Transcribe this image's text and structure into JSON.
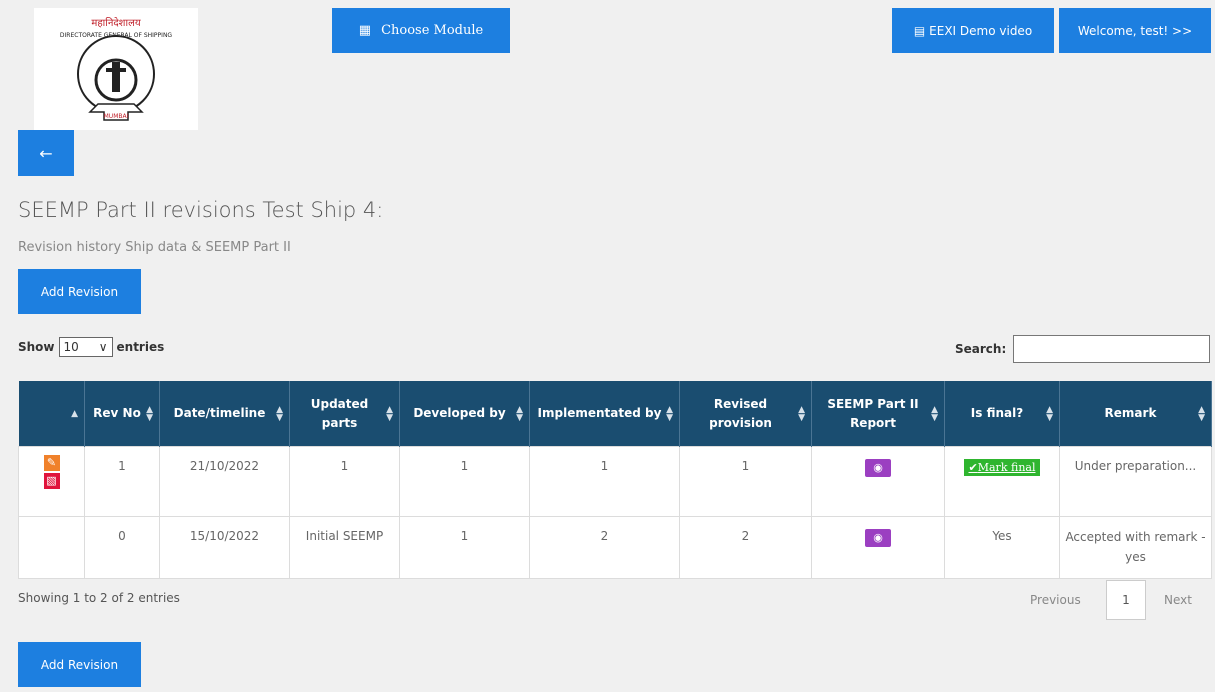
{
  "header": {
    "logo_text": "DIRECTORATE GENERAL OF SHIPPING",
    "logo_sub": "MUMBAI",
    "choose_module": "Choose Module",
    "demo_video": "EEXI Demo video",
    "welcome": "Welcome, test! >>"
  },
  "page": {
    "title": "SEEMP Part II revisions Test Ship 4:",
    "subtitle": "Revision history Ship data & SEEMP Part II",
    "add_revision": "Add Revision"
  },
  "controls": {
    "show_label": "Show",
    "entries_value": "10",
    "entries_label": "entries",
    "search_label": "Search:"
  },
  "table": {
    "headers": [
      "",
      "Rev No",
      "Date/timeline",
      "Updated parts",
      "Developed by",
      "Implementated by",
      "Revised provision",
      "SEEMP Part II Report",
      "Is final?",
      "Remark"
    ],
    "rows": [
      {
        "rev_no": "1",
        "date": "21/10/2022",
        "updated": "1",
        "developed": "1",
        "implemented": "1",
        "revised": "1",
        "is_final": "Mark final",
        "remark": "Under preparation..."
      },
      {
        "rev_no": "0",
        "date": "15/10/2022",
        "updated": "Initial SEEMP",
        "developed": "1",
        "implemented": "2",
        "revised": "2",
        "is_final": "Yes",
        "remark": "Accepted with remark - yes"
      }
    ]
  },
  "footer": {
    "showing": "Showing 1 to 2 of 2 entries",
    "previous": "Previous",
    "page": "1",
    "next": "Next"
  },
  "colors": {
    "primary": "#1d7fe0",
    "table_header": "#1a4d70",
    "edit": "#f0812a",
    "delete": "#e0143c",
    "view": "#9b3fc1",
    "final": "#2fb52f"
  }
}
